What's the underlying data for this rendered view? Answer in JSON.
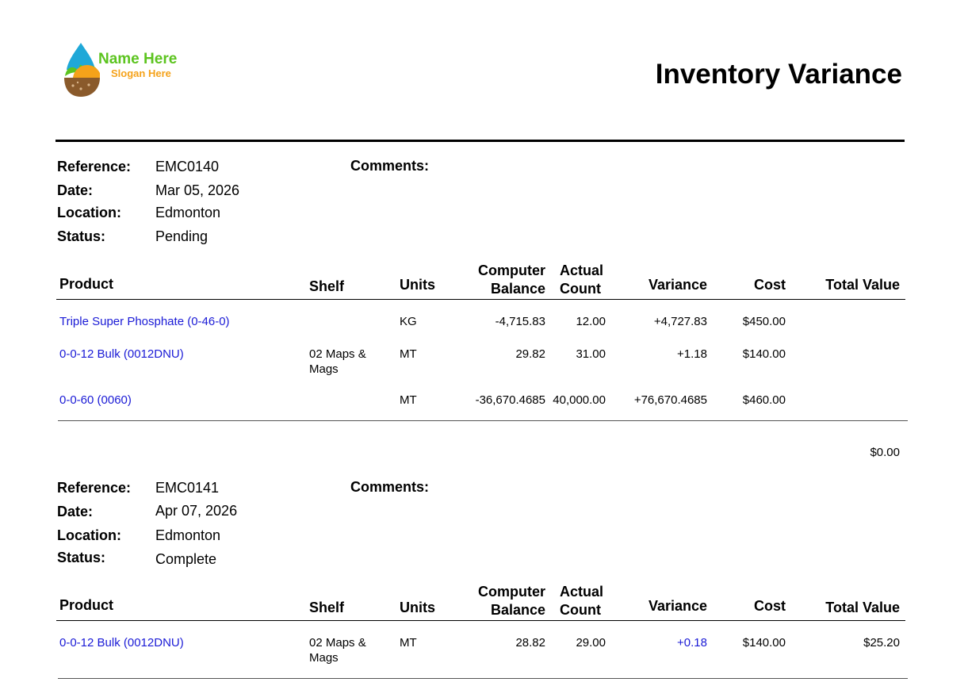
{
  "logo": {
    "name": "Name Here",
    "slogan": "Slogan Here",
    "colors": {
      "drop": "#1fa8d8",
      "leaf": "#5cc41f",
      "sun": "#f5a21a",
      "soil": "#8a5a2b"
    }
  },
  "title": "Inventory Variance",
  "labels": {
    "reference": "Reference:",
    "date": "Date:",
    "location": "Location:",
    "status": "Status:",
    "comments": "Comments:"
  },
  "columns": {
    "product": "Product",
    "shelf": "Shelf",
    "units": "Units",
    "computer_balance_1": "Computer",
    "computer_balance_2": "Balance",
    "actual_count_1": "Actual",
    "actual_count_2": "Count",
    "variance": "Variance",
    "cost": "Cost",
    "total_value": "Total Value"
  },
  "records": [
    {
      "reference": "EMC0140",
      "date": "Mar 05, 2026",
      "location": "Edmonton",
      "status": "Pending",
      "rows": [
        {
          "product": "Triple Super Phosphate (0-46-0)",
          "shelf": "",
          "units": "KG",
          "computer_balance": "-4,715.83",
          "actual_count": "12.00",
          "variance": "+4,727.83",
          "cost": "$450.00",
          "total_value": ""
        },
        {
          "product": "0-0-12 Bulk (0012DNU)",
          "shelf": "02 Maps & Mags",
          "units": "MT",
          "computer_balance": "29.82",
          "actual_count": "31.00",
          "variance": "+1.18",
          "cost": "$140.00",
          "total_value": ""
        },
        {
          "product": "0-0-60 (0060)",
          "shelf": "",
          "units": "MT",
          "computer_balance": "-36,670.4685",
          "actual_count": "40,000.00",
          "variance": "+76,670.4685",
          "cost": "$460.00",
          "total_value": ""
        }
      ],
      "subtotal": "$0.00"
    },
    {
      "reference": "EMC0141",
      "date": "Apr 07, 2026",
      "location": "Edmonton",
      "status": "Complete",
      "rows": [
        {
          "product": "0-0-12 Bulk (0012DNU)",
          "shelf": "02 Maps & Mags",
          "units": "MT",
          "computer_balance": "28.82",
          "actual_count": "29.00",
          "variance": "+0.18",
          "cost": "$140.00",
          "total_value": "$25.20"
        }
      ]
    }
  ]
}
